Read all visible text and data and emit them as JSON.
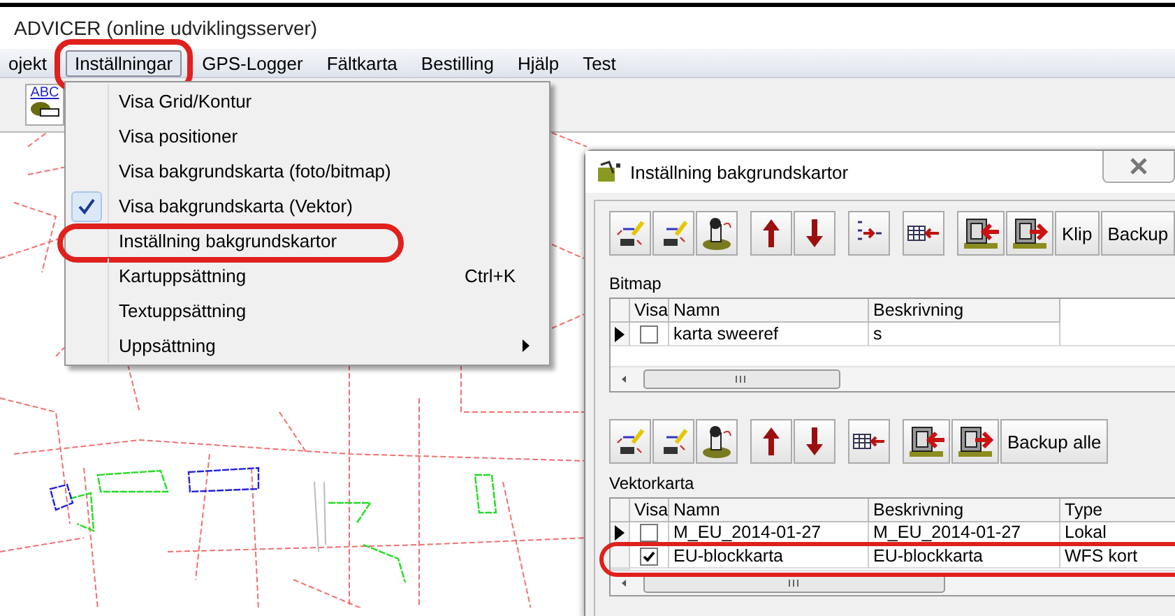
{
  "window": {
    "title": "ADVICER (online udviklingsserver)"
  },
  "menubar": [
    {
      "label": "ojekt",
      "selected": false,
      "circled": false
    },
    {
      "label": "Inställningar",
      "selected": true,
      "circled": true
    },
    {
      "label": "GPS-Logger",
      "selected": false,
      "circled": false
    },
    {
      "label": "Fältkarta",
      "selected": false,
      "circled": false
    },
    {
      "label": "Bestilling",
      "selected": false,
      "circled": false
    },
    {
      "label": "Hjälp",
      "selected": false,
      "circled": false
    },
    {
      "label": "Test",
      "selected": false,
      "circled": false
    }
  ],
  "toolbar": {
    "abc_label": "ABC"
  },
  "menu": {
    "items": [
      {
        "label": "Visa Grid/Kontur",
        "checked": false,
        "submenu": false,
        "circled": false
      },
      {
        "label": "Visa positioner",
        "checked": false,
        "submenu": false,
        "circled": false
      },
      {
        "label": "Visa bakgrundskarta (foto/bitmap)",
        "checked": false,
        "submenu": false,
        "circled": false
      },
      {
        "label": "Visa bakgrundskarta (Vektor)",
        "checked": true,
        "submenu": false,
        "circled": false
      },
      {
        "label": "Inställning bakgrundskartor",
        "checked": false,
        "submenu": false,
        "circled": true
      },
      {
        "label": "Kartuppsättning",
        "shortcut": "Ctrl+K",
        "checked": false,
        "submenu": false,
        "circled": false
      },
      {
        "label": "Textuppsättning",
        "checked": false,
        "submenu": false,
        "circled": false
      },
      {
        "label": "Uppsättning",
        "checked": false,
        "submenu": true,
        "circled": false
      }
    ]
  },
  "dialog": {
    "title": "Inställning bakgrundskartor",
    "bitmap": {
      "toolbar": [
        {
          "kind": "edit"
        },
        {
          "kind": "editalt"
        },
        {
          "kind": "stamp"
        },
        {
          "kind": "up"
        },
        {
          "kind": "down"
        },
        {
          "kind": "split"
        },
        {
          "kind": "table"
        },
        {
          "kind": "dbin"
        },
        {
          "kind": "dbout"
        },
        {
          "kind": "text",
          "label": "Klip"
        },
        {
          "kind": "text",
          "label": "Backup"
        }
      ],
      "label": "Bitmap",
      "columns": [
        "Visa",
        "Namn",
        "Beskrivning"
      ],
      "rows": [
        {
          "current": true,
          "circled": false,
          "cells": [
            {
              "kind": "checkbox",
              "checked": false
            },
            {
              "kind": "text",
              "text": "karta sweeref"
            },
            {
              "kind": "text",
              "text": "s"
            }
          ]
        }
      ]
    },
    "vektor": {
      "toolbar": [
        {
          "kind": "edit"
        },
        {
          "kind": "editalt"
        },
        {
          "kind": "stamp"
        },
        {
          "kind": "up"
        },
        {
          "kind": "down"
        },
        {
          "kind": "table"
        },
        {
          "kind": "dbin"
        },
        {
          "kind": "dbout"
        },
        {
          "kind": "text",
          "label": "Backup alle"
        }
      ],
      "label": "Vektorkarta",
      "columns": [
        "Visa",
        "Namn",
        "Beskrivning",
        "Type"
      ],
      "rows": [
        {
          "current": true,
          "circled": false,
          "cells": [
            {
              "kind": "checkbox",
              "checked": false
            },
            {
              "kind": "text",
              "text": "M_EU_2014-01-27"
            },
            {
              "kind": "text",
              "text": "M_EU_2014-01-27"
            },
            {
              "kind": "text",
              "text": "Lokal"
            }
          ]
        },
        {
          "current": false,
          "circled": true,
          "cells": [
            {
              "kind": "checkbox",
              "checked": true
            },
            {
              "kind": "text",
              "text": "EU-blockkarta"
            },
            {
              "kind": "text",
              "text": "EU-blockkarta"
            },
            {
              "kind": "text",
              "text": "WFS kort"
            }
          ]
        }
      ]
    }
  }
}
